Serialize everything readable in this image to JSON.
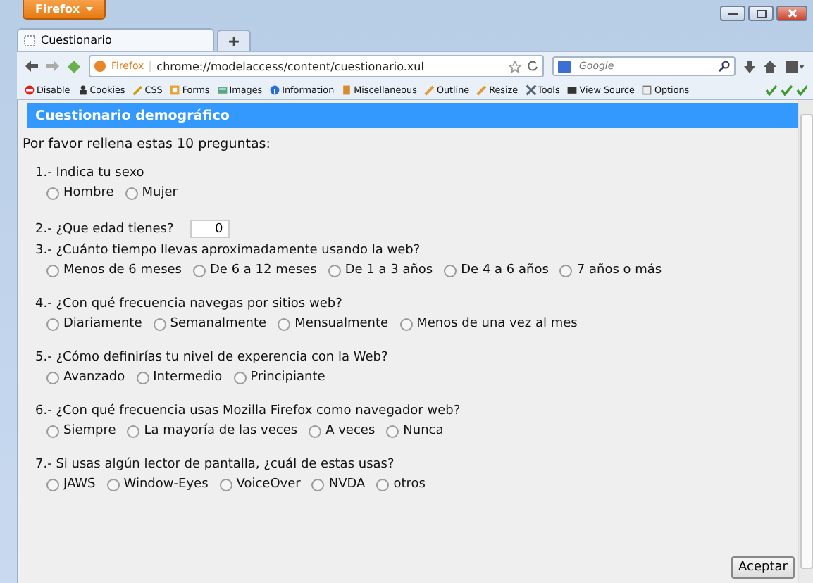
{
  "app_button": "Firefox",
  "tabs": [
    {
      "label": "Cuestionario",
      "selected": true
    }
  ],
  "new_tab": "+",
  "address": {
    "identity": "Firefox",
    "url": "chrome://modelaccess/content/cuestionario.xul"
  },
  "search": {
    "placeholder": "Google"
  },
  "dev_toolbar": [
    {
      "label": "Disable"
    },
    {
      "label": "Cookies"
    },
    {
      "label": "CSS"
    },
    {
      "label": "Forms"
    },
    {
      "label": "Images"
    },
    {
      "label": "Information"
    },
    {
      "label": "Miscellaneous"
    },
    {
      "label": "Outline"
    },
    {
      "label": "Resize"
    },
    {
      "label": "Tools"
    },
    {
      "label": "View Source"
    },
    {
      "label": "Options"
    }
  ],
  "page": {
    "title": "Cuestionario demográfico",
    "intro": "Por favor rellena estas 10 preguntas:",
    "questions": [
      {
        "kind": "radio",
        "label": "1.- Indica tu sexo",
        "options": [
          {
            "label": "Hombre",
            "selected": false
          },
          {
            "label": "Mujer",
            "selected": false
          }
        ]
      },
      {
        "kind": "number",
        "label": "2.- ¿Que edad tienes?",
        "value": "0"
      },
      {
        "kind": "radio",
        "label": "3.- ¿Cuánto tiempo llevas aproximadamente usando la web?",
        "options": [
          {
            "label": "Menos de 6 meses",
            "selected": false
          },
          {
            "label": "De 6 a 12 meses",
            "selected": false
          },
          {
            "label": "De 1 a 3 años",
            "selected": false
          },
          {
            "label": "De 4 a 6 años",
            "selected": false
          },
          {
            "label": "7 años o más",
            "selected": false
          }
        ]
      },
      {
        "kind": "radio",
        "label": "4.- ¿Con qué frecuencia navegas por sitios web?",
        "options": [
          {
            "label": "Diariamente",
            "selected": false
          },
          {
            "label": "Semanalmente",
            "selected": false
          },
          {
            "label": "Mensualmente",
            "selected": false
          },
          {
            "label": "Menos de una vez al mes",
            "selected": false
          }
        ]
      },
      {
        "kind": "radio",
        "label": "5.- ¿Cómo definirías tu nivel de experencia con la Web?",
        "options": [
          {
            "label": "Avanzado",
            "selected": false
          },
          {
            "label": "Intermedio",
            "selected": false
          },
          {
            "label": "Principiante",
            "selected": false
          }
        ]
      },
      {
        "kind": "radio",
        "label": "6.- ¿Con qué frecuencia usas Mozilla Firefox como navegador web?",
        "options": [
          {
            "label": "Siempre",
            "selected": false
          },
          {
            "label": "La mayoría de las veces",
            "selected": false
          },
          {
            "label": "A veces",
            "selected": false
          },
          {
            "label": "Nunca",
            "selected": false
          }
        ]
      },
      {
        "kind": "radio",
        "label": "7.- Si usas algún lector de pantalla, ¿cuál de estas usas?",
        "options": [
          {
            "label": "JAWS",
            "selected": false
          },
          {
            "label": "Window-Eyes",
            "selected": false
          },
          {
            "label": "VoiceOver",
            "selected": false
          },
          {
            "label": "NVDA",
            "selected": false
          },
          {
            "label": "otros",
            "selected": false
          }
        ]
      }
    ],
    "submit": "Aceptar"
  }
}
